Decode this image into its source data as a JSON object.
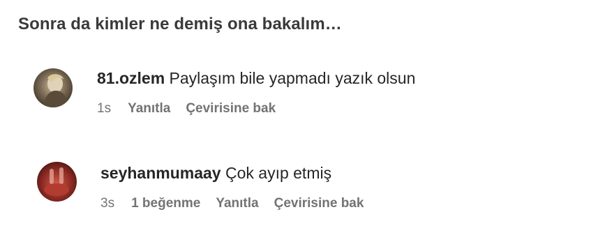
{
  "heading": "Sonra da kimler ne demiş ona bakalım…",
  "comments": [
    {
      "username": "81.ozlem",
      "text": "Paylaşım bile yapmadı yazık olsun",
      "time": "1s",
      "likes": "",
      "reply_label": "Yanıtla",
      "translate_label": "Çevirisine bak"
    },
    {
      "username": "seyhanmumaay",
      "text": "Çok ayıp etmiş",
      "time": "3s",
      "likes": "1 beğenme",
      "reply_label": "Yanıtla",
      "translate_label": "Çevirisine bak"
    }
  ]
}
